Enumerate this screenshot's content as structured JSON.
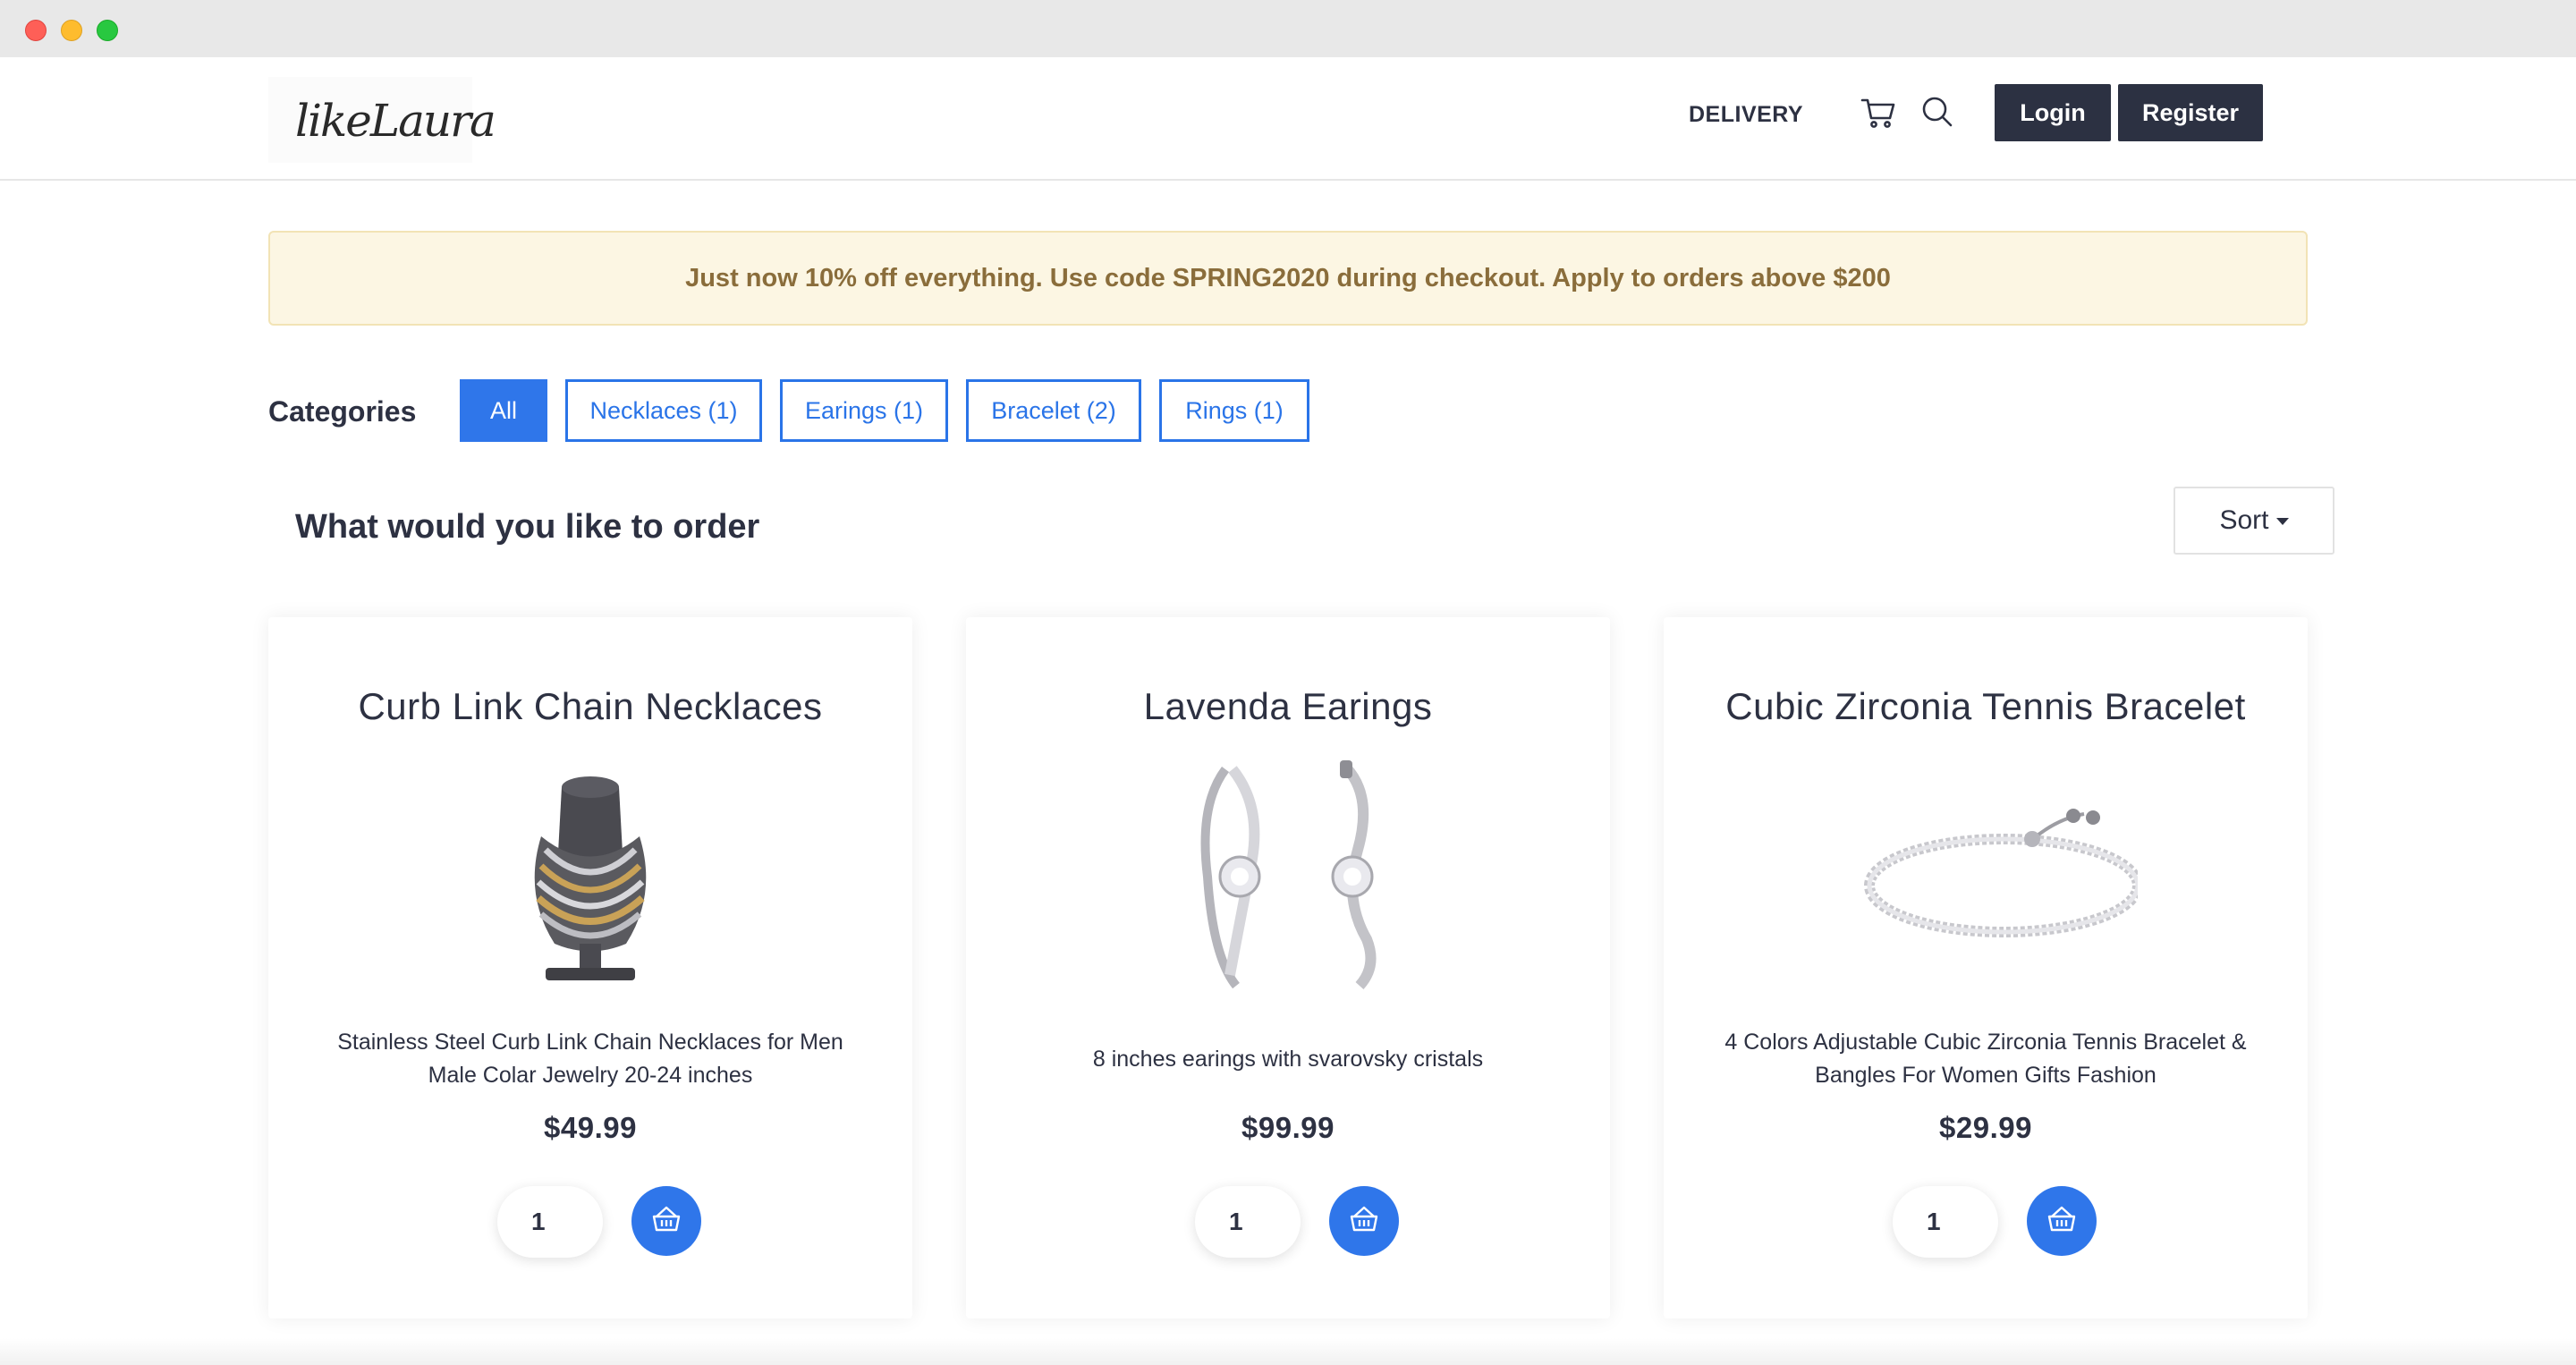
{
  "header": {
    "logo_text": "likeLaura",
    "nav_delivery": "DELIVERY",
    "cart_icon": "cart-icon",
    "search_icon": "search-icon",
    "login_label": "Login",
    "register_label": "Register"
  },
  "promo": {
    "text": "Just now 10% off everything. Use code SPRING2020 during checkout. Apply to orders above $200"
  },
  "categories": {
    "label": "Categories",
    "items": [
      {
        "label": "All",
        "active": true
      },
      {
        "label": "Necklaces (1)",
        "active": false
      },
      {
        "label": "Earings (1)",
        "active": false
      },
      {
        "label": "Bracelet (2)",
        "active": false
      },
      {
        "label": "Rings (1)",
        "active": false
      }
    ]
  },
  "main": {
    "heading": "What would you like to order",
    "sort_label": "Sort"
  },
  "products": [
    {
      "title": "Curb Link Chain Necklaces",
      "description": "Stainless Steel Curb Link Chain Necklaces for Men Male Colar Jewelry 20-24 inches",
      "price": "$49.99",
      "quantity": "1",
      "image": "necklace-image"
    },
    {
      "title": "Lavenda Earings",
      "description": "8 inches earings with svarovsky cristals",
      "price": "$99.99",
      "quantity": "1",
      "image": "earrings-image"
    },
    {
      "title": "Cubic Zirconia Tennis Bracelet",
      "description": "4 Colors Adjustable Cubic Zirconia Tennis Bracelet & Bangles For Women Gifts Fashion",
      "price": "$29.99",
      "quantity": "1",
      "image": "bracelet-image"
    }
  ],
  "colors": {
    "accent": "#2f76ea",
    "dark_button": "#2c3142",
    "promo_bg": "#fcf6e3",
    "promo_text": "#8a6d3b"
  }
}
